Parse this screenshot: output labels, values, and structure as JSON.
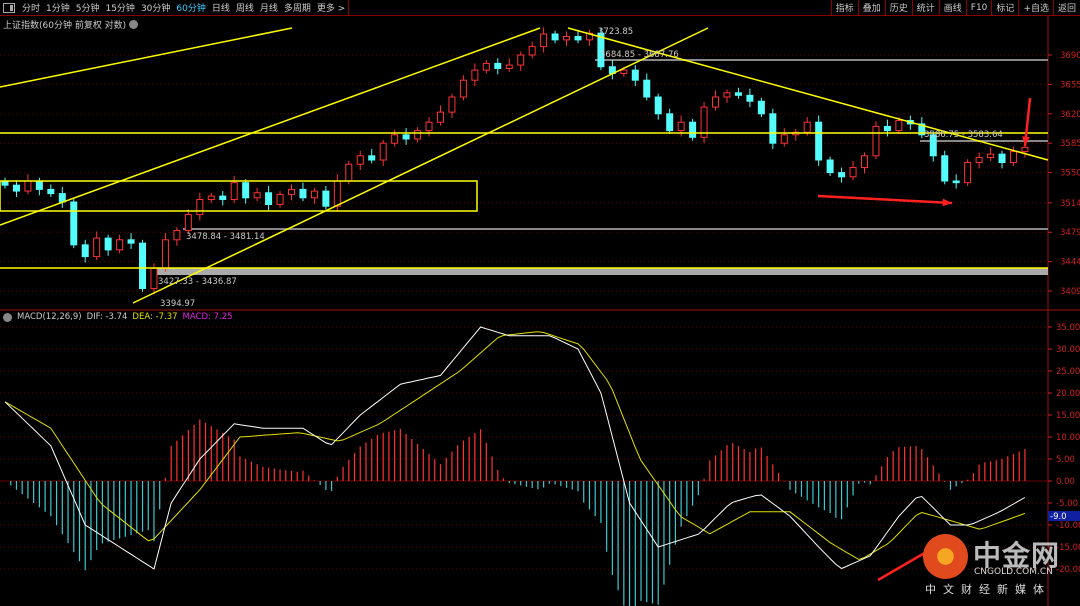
{
  "toolbar": {
    "periods": [
      "分时",
      "1分钟",
      "5分钟",
      "15分钟",
      "30分钟",
      "60分钟",
      "日线",
      "周线",
      "月线",
      "多周期",
      "更多 >"
    ],
    "active_period": "60分钟",
    "right_buttons": [
      "指标",
      "叠加",
      "历史",
      "统计",
      "画线",
      "F10",
      "标记",
      "+自选",
      "返回"
    ]
  },
  "title": "上证指数(60分钟 前复权 对数)",
  "macd_legend": {
    "name": "MACD(12,26,9)",
    "dif": "DIF: -3.74",
    "dea": "DEA: -7.37",
    "macd": "MACD: 7.25"
  },
  "colors": {
    "up": "#ff3232",
    "down": "#54fcfc",
    "dif": "#ffffff",
    "dea": "#e0e000",
    "axis": "#d02020",
    "drawing": "#ffff00"
  },
  "logo": {
    "cn": "中金网",
    "en": "CNGOLD.COM.CN",
    "sub": "中文财经新媒体"
  },
  "chart_data": [
    {
      "type": "candlestick",
      "title": "上证指数(60分钟 前复权 对数)",
      "y_ticks": [
        "3690",
        "3655",
        "3620",
        "3585",
        "3550",
        "3514",
        "3479",
        "3444",
        "3409"
      ],
      "ylim": [
        3380,
        3735
      ],
      "annotations": [
        "3723.85",
        "3684.85 - 3687.76",
        "3586.75 - 3583.64",
        "3478.84 - 3481.14",
        "3427.33 - 3436.87",
        "3394.97"
      ],
      "close": [
        3535,
        3528,
        3540,
        3530,
        3525,
        3515,
        3464,
        3450,
        3472,
        3458,
        3470,
        3466,
        3412,
        3436,
        3470,
        3481,
        3500,
        3518,
        3522,
        3518,
        3538,
        3520,
        3526,
        3512,
        3524,
        3530,
        3520,
        3528,
        3510,
        3540,
        3560,
        3570,
        3565,
        3585,
        3595,
        3590,
        3600,
        3610,
        3622,
        3640,
        3660,
        3672,
        3680,
        3674,
        3678,
        3690,
        3700,
        3715,
        3708,
        3712,
        3708,
        3716,
        3676,
        3668,
        3672,
        3660,
        3640,
        3620,
        3600,
        3610,
        3592,
        3628,
        3640,
        3645,
        3642,
        3635,
        3620,
        3585,
        3595,
        3598,
        3610,
        3565,
        3550,
        3545,
        3556,
        3570,
        3605,
        3600,
        3612,
        3608,
        3595,
        3570,
        3540,
        3538,
        3562,
        3568,
        3572,
        3562,
        3575,
        3580
      ]
    },
    {
      "type": "line+bar",
      "title": "MACD(12,26,9)",
      "y_ticks": [
        "35.00",
        "30.00",
        "25.00",
        "20.00",
        "15.00",
        "10.00",
        "5.00",
        "0.00",
        "-5.00",
        "-10.00",
        "-15.00",
        "-20.00"
      ],
      "ylim": [
        -28,
        37
      ],
      "current_marker": "-9.0",
      "dif_keypoints": [
        [
          0,
          18
        ],
        [
          4,
          8
        ],
        [
          7,
          -10
        ],
        [
          10,
          -15
        ],
        [
          13,
          -20
        ],
        [
          14.5,
          -5
        ],
        [
          17,
          5
        ],
        [
          20,
          13
        ],
        [
          22.5,
          12
        ],
        [
          26,
          12
        ],
        [
          28.4,
          8
        ],
        [
          31,
          15
        ],
        [
          34.5,
          22
        ],
        [
          38,
          24
        ],
        [
          41.5,
          35
        ],
        [
          44,
          33
        ],
        [
          47.6,
          33
        ],
        [
          50,
          30
        ],
        [
          52,
          20
        ],
        [
          54.5,
          -5
        ],
        [
          57,
          -15
        ],
        [
          60.6,
          -12
        ],
        [
          63.3,
          -5
        ],
        [
          65.9,
          -3
        ],
        [
          68.5,
          -8
        ],
        [
          71,
          -15
        ],
        [
          72.9,
          -20
        ],
        [
          75.5,
          -17
        ],
        [
          78,
          -8
        ],
        [
          79.8,
          -3
        ],
        [
          82.5,
          -10
        ],
        [
          84.2,
          -10
        ],
        [
          86.8,
          -7
        ],
        [
          89,
          -3.74
        ]
      ],
      "dea_keypoints": [
        [
          0,
          18
        ],
        [
          4,
          12
        ],
        [
          8.3,
          -5
        ],
        [
          12.7,
          -14
        ],
        [
          17,
          -2
        ],
        [
          20.5,
          10
        ],
        [
          25.7,
          11
        ],
        [
          29.2,
          9
        ],
        [
          32.7,
          13
        ],
        [
          36.2,
          19
        ],
        [
          39.7,
          25
        ],
        [
          43.2,
          33
        ],
        [
          46.7,
          34
        ],
        [
          50.2,
          31
        ],
        [
          52.8,
          22
        ],
        [
          55.4,
          5
        ],
        [
          58.9,
          -8
        ],
        [
          61.5,
          -12
        ],
        [
          65,
          -7
        ],
        [
          68.5,
          -7
        ],
        [
          72,
          -14
        ],
        [
          74.6,
          -18
        ],
        [
          77.2,
          -14
        ],
        [
          79.8,
          -7
        ],
        [
          82.5,
          -9
        ],
        [
          85.1,
          -11
        ],
        [
          89,
          -7.37
        ]
      ]
    }
  ]
}
